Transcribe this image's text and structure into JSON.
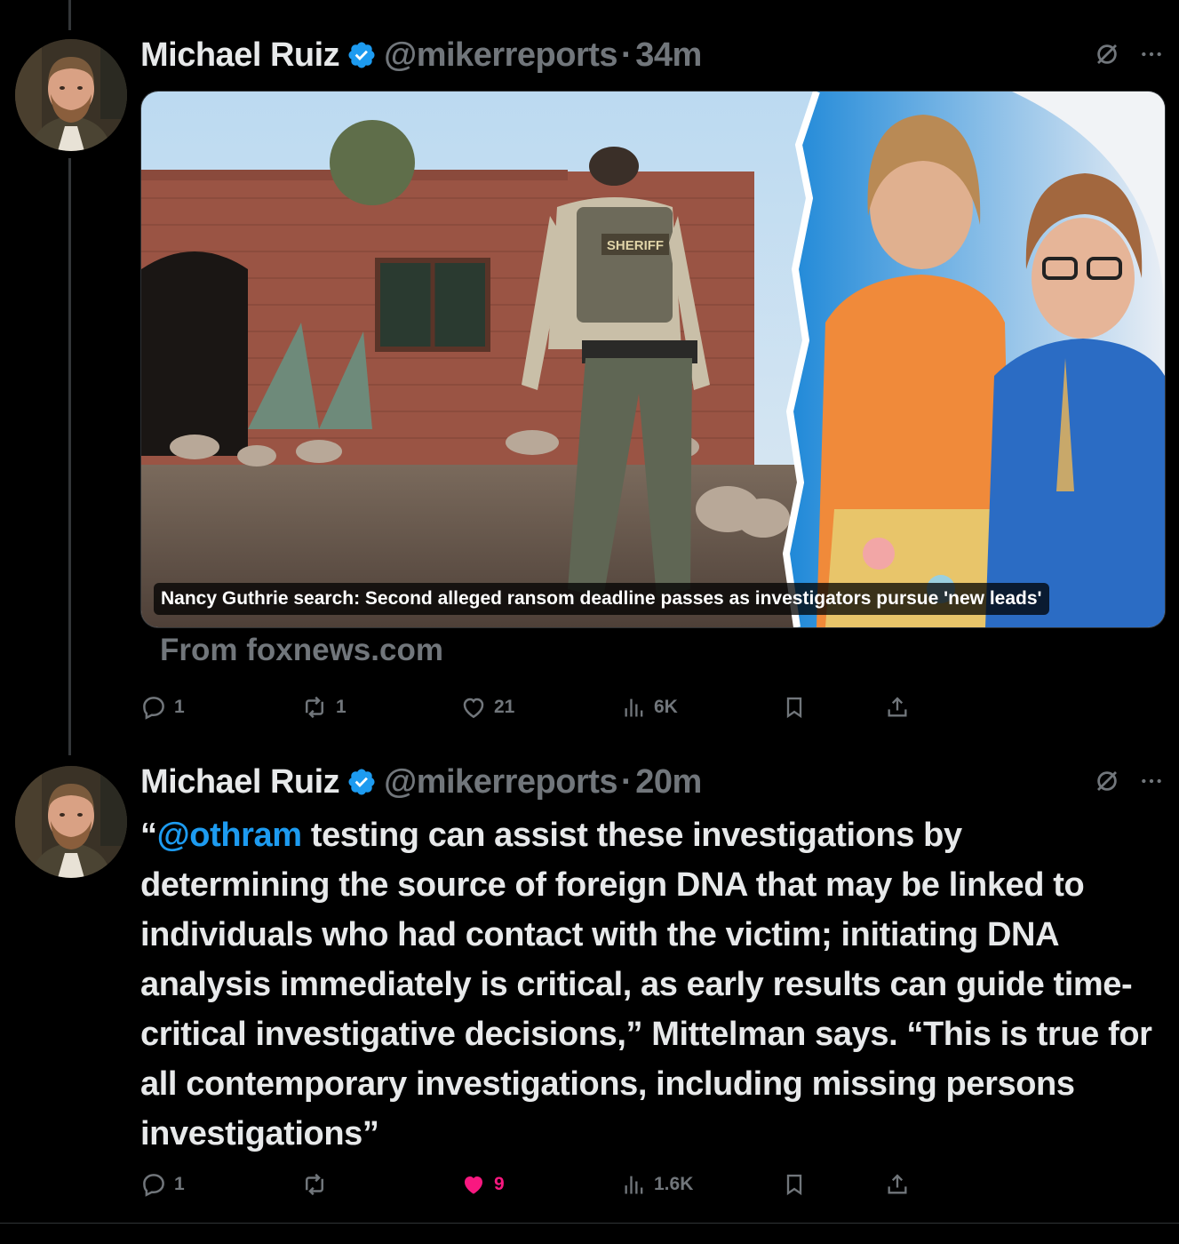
{
  "colors": {
    "background": "#000000",
    "text": "#e7e9ea",
    "muted": "#71767b",
    "link": "#1d9bf0",
    "verified": "#1d9bf0",
    "like_active": "#f91880"
  },
  "tweets": [
    {
      "author_name": "Michael Ruiz",
      "handle": "@mikerreports",
      "separator": "·",
      "time": "34m",
      "media": {
        "caption": "Nancy Guthrie search: Second alleged ransom deadline passes as investigators pursue 'new leads'",
        "vest_text": "SHERIFF"
      },
      "source": "From foxnews.com",
      "actions": {
        "replies": "1",
        "reposts": "1",
        "likes": "21",
        "views": "6K"
      },
      "liked": false
    },
    {
      "author_name": "Michael Ruiz",
      "handle": "@mikerreports",
      "separator": "·",
      "time": "20m",
      "text_prefix": "“",
      "mention": "@othram",
      "text_body": " testing can assist these investigations by determining the source of foreign DNA that may be linked to individuals who had contact with the victim; initiating DNA analysis immediately is critical, as early results can guide time-critical investigative decisions,” Mittelman says. “This is true for all contemporary investigations, including missing persons investigations”",
      "actions": {
        "replies": "1",
        "reposts": "",
        "likes": "9",
        "views": "1.6K"
      },
      "liked": true
    }
  ],
  "icons": [
    "reply-icon",
    "repost-icon",
    "like-icon",
    "views-icon",
    "bookmark-icon",
    "share-icon",
    "grok-icon",
    "more-icon",
    "verified-icon"
  ]
}
